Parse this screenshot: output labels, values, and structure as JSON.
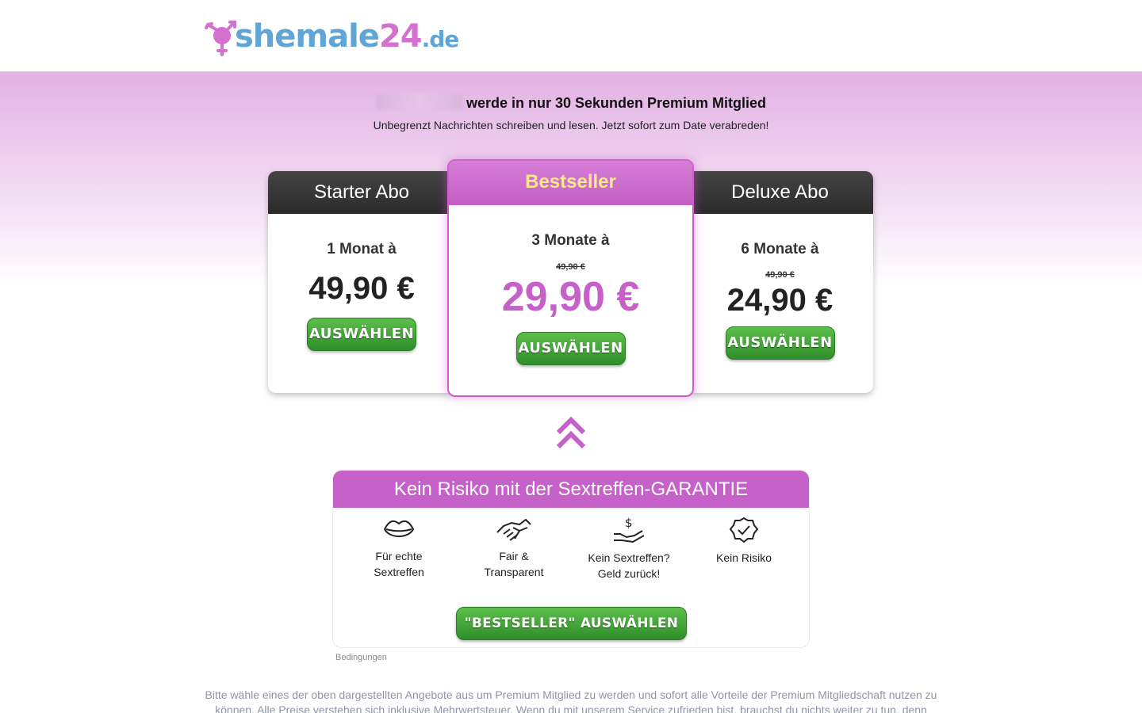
{
  "logo": {
    "part1": "shemale",
    "part2": "24",
    "tld": ".de"
  },
  "promo": {
    "headline": "werde in nur 30 Sekunden Premium Mitglied",
    "subline": "Unbegrenzt Nachrichten schreiben und lesen. Jetzt sofort zum Date verabreden!"
  },
  "plans": [
    {
      "title": "Starter Abo",
      "term": "1 Monat à",
      "old_price": "",
      "price": "49,90 €",
      "button": "AUSWÄHLEN"
    },
    {
      "title": "Bestseller",
      "term": "3 Monate à",
      "old_price": "49,90 €",
      "price": "29,90 €",
      "button": "AUSWÄHLEN"
    },
    {
      "title": "Deluxe Abo",
      "term": "6 Monate à",
      "old_price": "49,90 €",
      "price": "24,90 €",
      "button": "AUSWÄHLEN"
    }
  ],
  "guarantee": {
    "title": "Kein Risiko mit der Sextreffen-GARANTIE",
    "features": [
      {
        "icon": "lips-icon",
        "line1": "Für echte",
        "line2": "Sextreffen"
      },
      {
        "icon": "handshake-icon",
        "line1": "Fair &",
        "line2": "Transparent"
      },
      {
        "icon": "money-back-hand-icon",
        "line1": "Kein Sextreffen?",
        "line2": "Geld zurück!"
      },
      {
        "icon": "check-badge-icon",
        "line1": "Kein Risiko",
        "line2": ""
      }
    ],
    "button": "\"BESTSELLER\" AUSWÄHLEN"
  },
  "conditions_link": "Bedingungen",
  "footer": {
    "text": "Bitte wähle eines der oben dargestellten Angebote aus um Premium Mitglied zu werden und sofort alle Vorteile der Premium Mitgliedschaft nutzen zu können. Alle Preise verstehen sich inklusive Mehrwertsteuer. Wenn du mit unserem Service zufrieden bist, brauchst du nichts weiter zu tun, denn"
  },
  "colors": {
    "brand_pink": "#c561c9",
    "brand_blue": "#5fa6d6",
    "button_green": "#3f9e35",
    "bestseller_yellow": "#ffe98a"
  }
}
